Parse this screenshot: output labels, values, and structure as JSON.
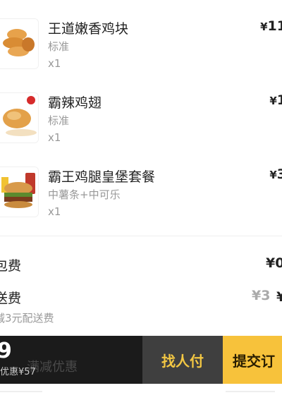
{
  "items": [
    {
      "name": "王道嫩香鸡块",
      "desc": "标准",
      "qty": "x1",
      "currency": "¥",
      "price": "11",
      "icon": "chicken-nuggets-image"
    },
    {
      "name": "霸辣鸡翅",
      "desc": "标准",
      "qty": "x1",
      "currency": "¥",
      "price": "1",
      "icon": "spicy-chicken-wings-image"
    },
    {
      "name": "霸王鸡腿皇堡套餐",
      "desc": "中薯条+中可乐",
      "qty": "x1",
      "currency": "¥",
      "price": "3",
      "icon": "burger-combo-image"
    }
  ],
  "fees": {
    "packing_label": "包费",
    "packing_value": "¥0",
    "delivery_label": "送费",
    "delivery_original": "¥3",
    "delivery_value": "¥",
    "delivery_note": "减3元配送费"
  },
  "bottom_bar": {
    "total": "9",
    "saved": "优惠¥57",
    "behind_text": "满减优惠",
    "pay_for_me": "找人付",
    "submit": "提交订"
  },
  "colors": {
    "accent_yellow": "#f7c23b",
    "dark_bar": "#1b1b1b",
    "mid_bar": "#3f3f3f"
  }
}
